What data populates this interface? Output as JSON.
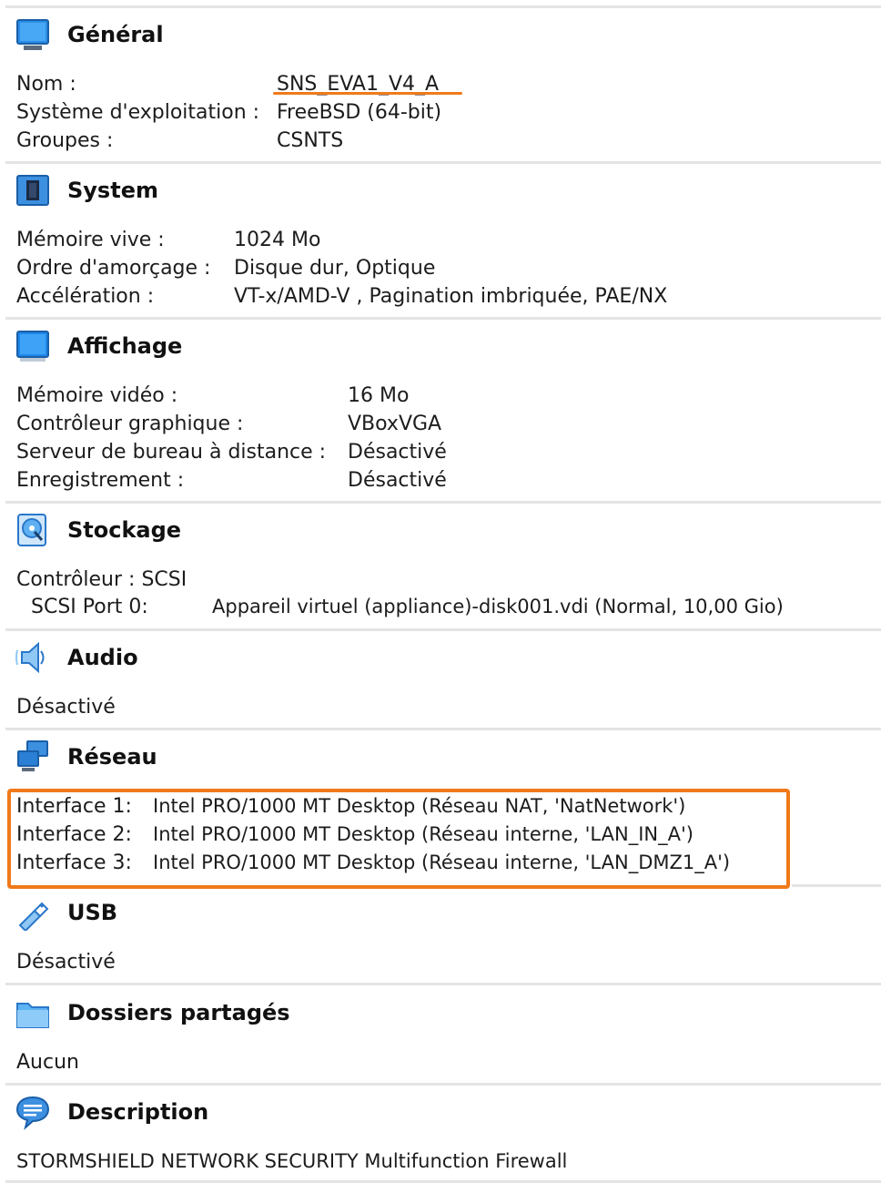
{
  "general": {
    "title": "Général",
    "name_label": "Nom :",
    "name_value": "SNS_EVA1_V4_A",
    "os_label": "Système d'exploitation :",
    "os_value": "FreeBSD (64-bit)",
    "groups_label": "Groupes :",
    "groups_value": "CSNTS"
  },
  "system": {
    "title": "System",
    "memory_label": "Mémoire vive :",
    "memory_value": "1024 Mo",
    "boot_label": "Ordre d'amorçage :",
    "boot_value": "Disque dur, Optique",
    "accel_label": "Accélération :",
    "accel_value": "VT-x/AMD-V , Pagination imbriquée, PAE/NX"
  },
  "display": {
    "title": "Affichage",
    "vram_label": "Mémoire vidéo :",
    "vram_value": "16 Mo",
    "controller_label": "Contrôleur graphique :",
    "controller_value": "VBoxVGA",
    "rdp_label": "Serveur de bureau à distance :",
    "rdp_value": "Désactivé",
    "recording_label": "Enregistrement :",
    "recording_value": "Désactivé"
  },
  "storage": {
    "title": "Stockage",
    "controller_line": "Contrôleur : SCSI",
    "port_label": "SCSI Port 0:",
    "port_value": "Appareil virtuel (appliance)-disk001.vdi (Normal, 10,00 Gio)"
  },
  "audio": {
    "title": "Audio",
    "value": "Désactivé"
  },
  "network": {
    "title": "Réseau",
    "interfaces": [
      {
        "label": "Interface 1:",
        "value": "Intel PRO/1000 MT Desktop (Réseau NAT, 'NatNetwork')"
      },
      {
        "label": "Interface 2:",
        "value": "Intel PRO/1000 MT Desktop (Réseau interne, 'LAN_IN_A')"
      },
      {
        "label": "Interface 3:",
        "value": "Intel PRO/1000 MT Desktop (Réseau interne, 'LAN_DMZ1_A')"
      }
    ]
  },
  "usb": {
    "title": "USB",
    "value": "Désactivé"
  },
  "shared_folders": {
    "title": "Dossiers partagés",
    "value": "Aucun"
  },
  "description": {
    "title": "Description",
    "value": "STORMSHIELD NETWORK SECURITY Multifunction Firewall"
  },
  "colors": {
    "highlight": "#f07a1a",
    "separator": "#e4e4e4",
    "icon_blue": "#1f7fd6"
  },
  "icons": [
    "monitor-icon",
    "chip-icon",
    "display-icon",
    "disk-icon",
    "speaker-icon",
    "network-icon",
    "usb-icon",
    "folder-icon",
    "speech-bubble-icon"
  ]
}
